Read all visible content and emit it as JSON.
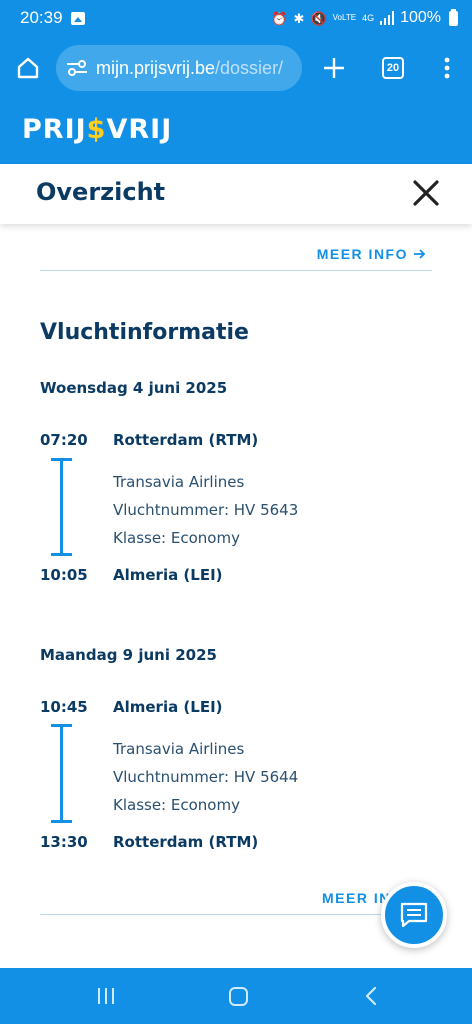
{
  "status": {
    "time": "20:39",
    "network": "4G",
    "volte": "VoLTE",
    "battery": "100%",
    "icons": [
      "gallery-icon",
      "alarm-icon",
      "bluetooth-icon",
      "mute-icon",
      "signal-icon",
      "battery-icon"
    ]
  },
  "browser": {
    "url_host": "mijn.prijsvrij.be",
    "url_path": "/dossier/",
    "tab_count": "20"
  },
  "site": {
    "logo_a": "PRIJ",
    "logo_dollar": "$",
    "logo_b": "VRIJ"
  },
  "header": {
    "title": "Overzicht"
  },
  "content": {
    "meer_info": "MEER INFO",
    "meer_info_bottom": "MEER IN",
    "section_title": "Vluchtinformatie",
    "flights": [
      {
        "date": "Woensdag 4 juni 2025",
        "departure_time": "07:20",
        "departure_place": "Rotterdam (RTM)",
        "airline": "Transavia Airlines",
        "flight_number": "Vluchtnummer: HV 5643",
        "class": "Klasse: Economy",
        "arrival_time": "10:05",
        "arrival_place": "Almeria (LEI)"
      },
      {
        "date": "Maandag 9 juni 2025",
        "departure_time": "10:45",
        "departure_place": "Almeria (LEI)",
        "airline": "Transavia Airlines",
        "flight_number": "Vluchtnummer: HV 5644",
        "class": "Klasse: Economy",
        "arrival_time": "13:30",
        "arrival_place": "Rotterdam (RTM)"
      }
    ]
  },
  "colors": {
    "brand_blue": "#1290e5",
    "navy": "#0b3a63",
    "logo_yellow": "#ffcc1f"
  }
}
